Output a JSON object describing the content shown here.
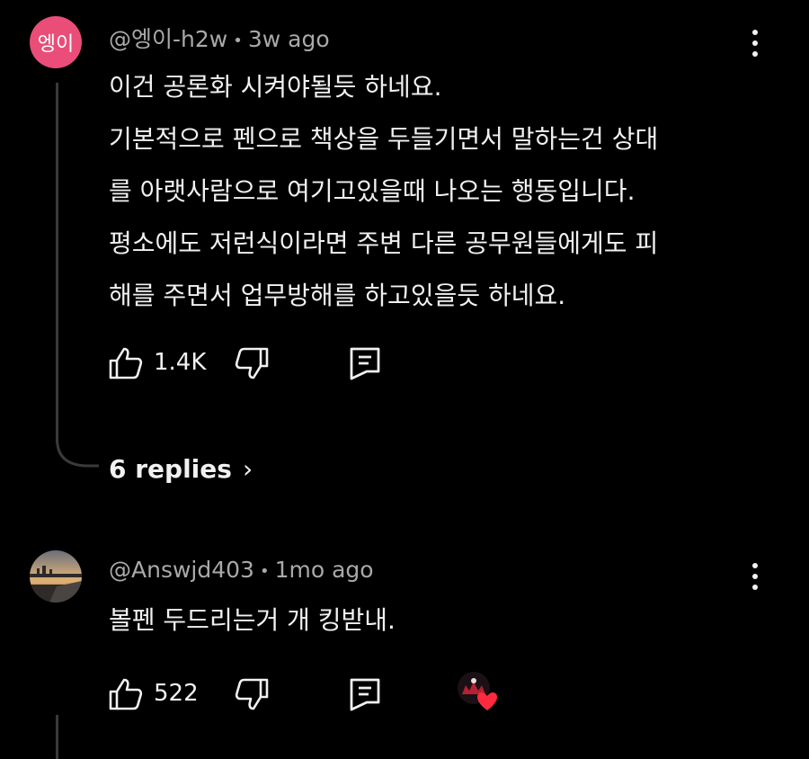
{
  "comments": [
    {
      "avatar_text": "엥이",
      "author": "@엥이-h2w",
      "time": "3w ago",
      "lines": [
        "이건 공론화 시켜야될듯 하네요.",
        "기본적으로 펜으로 책상을 두들기면서 말하는건 상대",
        "를 아랫사람으로 여기고있을때 나오는 행동입니다.",
        "평소에도 저런식이라면 주변 다른 공무원들에게도 피",
        "해를 주면서 업무방해를 하고있을듯 하네요."
      ],
      "like_count": "1.4K",
      "replies_label": "6 replies",
      "replies_chevron": "›"
    },
    {
      "author": "@Answjd403",
      "time": "1mo ago",
      "lines": [
        "볼펜 두드리는거 개 킹받내."
      ],
      "like_count": "522"
    }
  ],
  "separator": "•",
  "colors": {
    "background": "#000000",
    "text": "#f1f1f1",
    "meta": "#a9a9a9",
    "avatar_pink": "#e94d78",
    "heart_red": "#ff2a3d"
  },
  "icons": {
    "like": "thumbs-up-icon",
    "dislike": "thumbs-down-icon",
    "reply": "reply-comment-icon",
    "more": "more-vertical-icon",
    "creator_heart": "creator-heart-icon"
  }
}
